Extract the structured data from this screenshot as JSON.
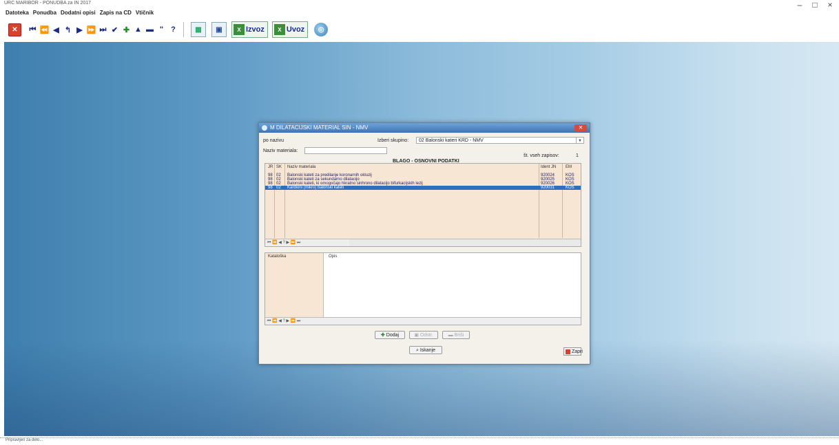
{
  "window": {
    "title": "URC MARIBOR - PONUDBA za IN 2017",
    "controls": [
      "–",
      "□",
      "×"
    ]
  },
  "menu": [
    "Datoteka",
    "Ponudba",
    "Dodatni opisi",
    "Zapis na CD",
    "Vtičnik"
  ],
  "toolbar": {
    "nav": [
      "⏮",
      "⏪",
      "◀",
      "↰",
      "▶",
      "⏩",
      "⏭",
      "✔",
      "✚",
      "▲",
      "▬",
      "\"",
      "?"
    ],
    "izvoz": "Izvoz",
    "uvoz": "Uvoz"
  },
  "dialog": {
    "title": "M DILATACIJSKI MATERIAL SIN - NMV",
    "po_nazivu": "po nazivu",
    "izberi_label": "Izberi skupino:",
    "izberi_value": "02 Balonski kateri KRD - NMV",
    "naziv_label": "Naziv materiala:",
    "st_zapisov_label": "št. vseh zapisov:",
    "st_zapisov_value": "1",
    "section_title": "BLAGO - OSNOVNI PODATKI",
    "columns": [
      "JR",
      "SK",
      "Naziv materiala",
      "Ident JN",
      "EM"
    ],
    "rows": [
      {
        "jr": "98",
        "sk": "02",
        "naziv": "Balonski kateti za predilanje koronarnih okluzij",
        "ident": "920024",
        "em": "KOS"
      },
      {
        "jr": "98",
        "sk": "02",
        "naziv": "Balonski kateti za sekundarno dilatacijo",
        "ident": "920025",
        "em": "KOS"
      },
      {
        "jr": "98",
        "sk": "02",
        "naziv": "Balonski kateti, ki omogočajo hkratno sinhrono dilatacijo bifurkacijskih lezij",
        "ident": "920026",
        "em": "KOS"
      },
      {
        "jr": "98",
        "sk": "02",
        "naziv": "Kardioni (mikro) balonski kateti",
        "ident": "920031",
        "em": "KOS"
      }
    ],
    "nav_text": "⏮ ⏪ ◀ ? ▶ ⏩ ⏭",
    "detail_col1": "Kataloška",
    "detail_col2": "Opis",
    "buttons": {
      "dodaj": "Dodaj",
      "odstrani": "Odstr.",
      "brisi": "Briši",
      "iskanje": "Iskanje",
      "zapri": "Zapri"
    }
  },
  "status": "Pripravljen za delo..."
}
